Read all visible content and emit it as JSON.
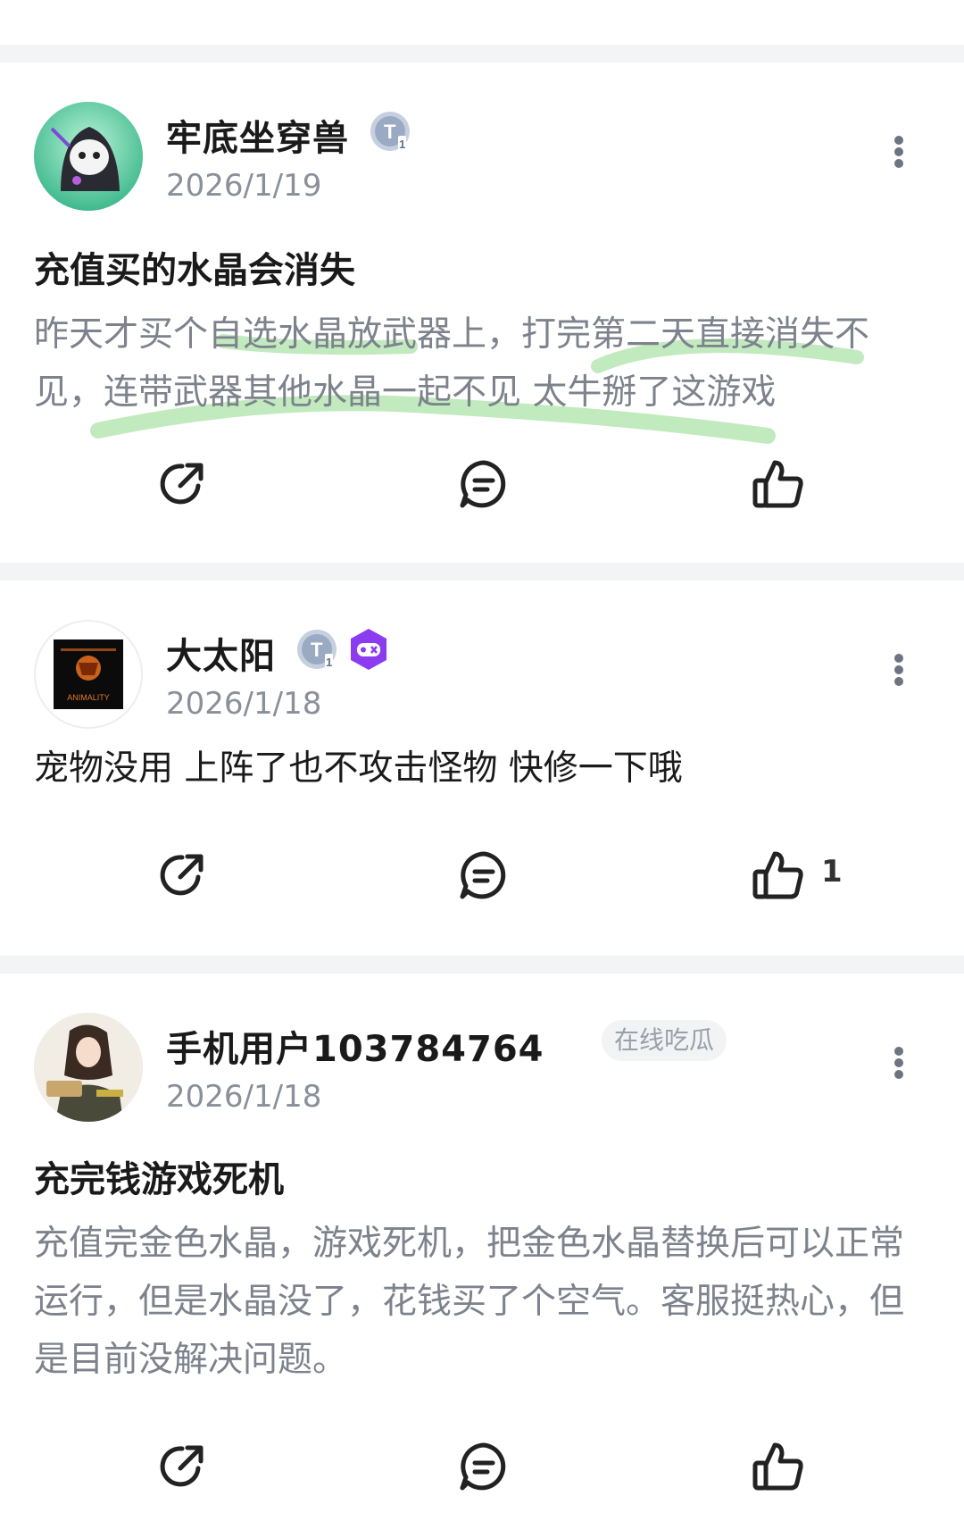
{
  "posts": [
    {
      "username": "牢底坐穿兽",
      "date": "2026/1/19",
      "badges": [
        "tier-badge-icon"
      ],
      "title": "充值买的水晶会消失",
      "body": "昨天才买个自选水晶放武器上，打完第二天直接消失不见，连带武器其他水晶一起不见 太牛掰了这游戏",
      "actions": {
        "share": "share-icon",
        "comment": "comment-icon",
        "like": "like-icon"
      },
      "like_count": ""
    },
    {
      "username": "大太阳",
      "date": "2026/1/18",
      "badges": [
        "tier-badge-icon",
        "gamepad-badge-icon"
      ],
      "title": "",
      "body": "宠物没用 上阵了也不攻击怪物 快修一下哦",
      "actions": {
        "share": "share-icon",
        "comment": "comment-icon",
        "like": "like-icon"
      },
      "like_count": "1"
    },
    {
      "username": "手机用户103784764",
      "date": "2026/1/18",
      "tag": "在线吃瓜",
      "title": "充完钱游戏死机",
      "body": "充值完金色水晶，游戏死机，把金色水晶替换后可以正常运行，但是水晶没了，花钱买了个空气。客服挺热心，但是目前没解决问题。",
      "actions": {
        "share": "share-icon",
        "comment": "comment-icon",
        "like": "like-icon"
      },
      "like_count": ""
    }
  ],
  "avatar_logo_text": "ANIMALITY",
  "colors": {
    "page_bg": "#f3f4f6",
    "card_bg": "#ffffff",
    "muted": "#7d828c",
    "highlight": "#8fd98a",
    "badge_purple": "#8b3cf0"
  }
}
